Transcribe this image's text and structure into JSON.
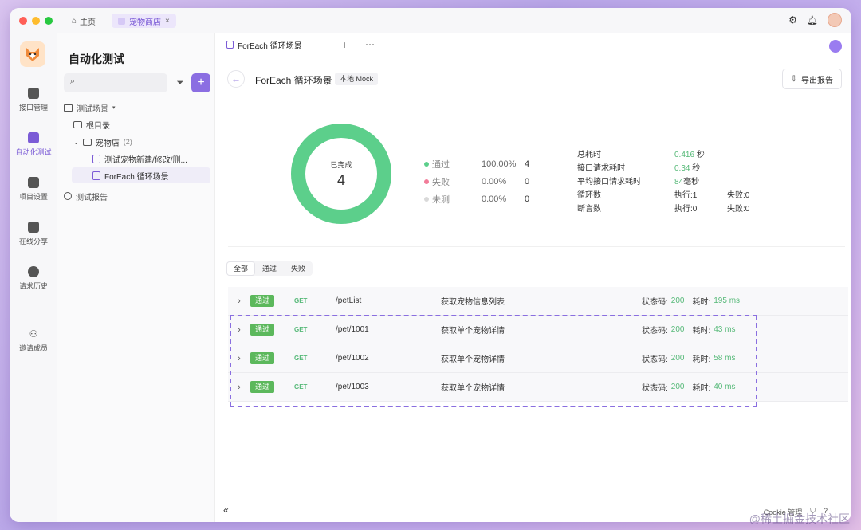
{
  "titlebar": {
    "tabs": [
      {
        "label": "主页",
        "icon": "home-icon"
      },
      {
        "label": "宠物商店",
        "icon": "shop-icon"
      }
    ],
    "colors": {
      "red": "#ff5f57",
      "yellow": "#febc2e",
      "green": "#28c840"
    }
  },
  "nav": {
    "items": [
      {
        "label": "接口管理",
        "icon": "api-icon"
      },
      {
        "label": "自动化测试",
        "icon": "automation-icon"
      },
      {
        "label": "项目设置",
        "icon": "settings-icon"
      },
      {
        "label": "在线分享",
        "icon": "share-icon"
      },
      {
        "label": "请求历史",
        "icon": "history-icon"
      },
      {
        "label": "邀请成员",
        "icon": "invite-icon"
      }
    ]
  },
  "tree": {
    "title": "自动化测试",
    "section_scenarios": "测试场景",
    "root": "根目录",
    "folder": {
      "name": "宠物店",
      "count": "(2)"
    },
    "items": [
      "测试宠物新建/修改/删...",
      "ForEach 循环场景"
    ],
    "section_reports": "测试报告"
  },
  "main": {
    "tab_label": "ForEach 循环场景",
    "scenario_title": "ForEach 循环场景",
    "mock_badge": "本地 Mock",
    "export_label": "导出报告",
    "donut": {
      "caption": "已完成",
      "count": "4",
      "pass_fraction": 1.0,
      "pass_color": "#5ccf8b"
    },
    "legend": [
      {
        "label": "通过",
        "pct": "100.00%",
        "count": "4",
        "color": "#5ccf8b"
      },
      {
        "label": "失败",
        "pct": "0.00%",
        "count": "0",
        "color": "#f27c99"
      },
      {
        "label": "未测",
        "pct": "0.00%",
        "count": "0",
        "color": "#d9d9d9"
      }
    ],
    "stats": [
      {
        "key": "总耗时",
        "v1": "0.416",
        "u1": " 秒",
        "v2": ""
      },
      {
        "key": "接口请求耗时",
        "v1": "0.34",
        "u1": " 秒",
        "v2": ""
      },
      {
        "key": "平均接口请求耗时",
        "v1": "84",
        "u1": "毫秒",
        "v2": ""
      },
      {
        "key": "循环数",
        "v1": "执行:1",
        "u1": "",
        "v2": "失败:0"
      },
      {
        "key": "断言数",
        "v1": "执行:0",
        "u1": "",
        "v2": "失败:0"
      }
    ],
    "filter_tabs": [
      "全部",
      "通过",
      "失败"
    ],
    "requests": [
      {
        "status_badge": "通过",
        "method": "GET",
        "path": "/petList",
        "desc": "获取宠物信息列表",
        "status_label": "状态码:",
        "status_code": "200",
        "time_label": "耗时:",
        "time": "195 ms"
      },
      {
        "status_badge": "通过",
        "method": "GET",
        "path": "/pet/1001",
        "desc": "获取单个宠物详情",
        "status_label": "状态码:",
        "status_code": "200",
        "time_label": "耗时:",
        "time": "43 ms"
      },
      {
        "status_badge": "通过",
        "method": "GET",
        "path": "/pet/1002",
        "desc": "获取单个宠物详情",
        "status_label": "状态码:",
        "status_code": "200",
        "time_label": "耗时:",
        "time": "58 ms"
      },
      {
        "status_badge": "通过",
        "method": "GET",
        "path": "/pet/1003",
        "desc": "获取单个宠物详情",
        "status_label": "状态码:",
        "status_code": "200",
        "time_label": "耗时:",
        "time": "40 ms"
      }
    ]
  },
  "footer": {
    "cookie_label": "Cookie 管理",
    "watermark": "@稀土掘金技术社区"
  }
}
